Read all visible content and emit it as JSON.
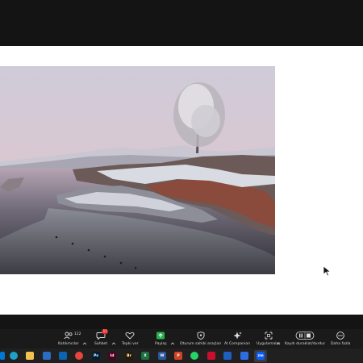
{
  "toolbar": {
    "participants": {
      "label": "Katılımcılar",
      "count": "122",
      "icon": "participants-icon"
    },
    "chat": {
      "label": "Sohbet",
      "badge": "11",
      "icon": "chat-icon"
    },
    "reactions": {
      "label": "Tepki ver",
      "icon": "heart-icon"
    },
    "share": {
      "label": "Paylaş",
      "icon": "share-screen-icon"
    },
    "host_tools": {
      "label": "Oturum sahibi araçları",
      "icon": "shield-icon"
    },
    "ai_companion": {
      "label": "AI Companion",
      "icon": "sparkle-icon"
    },
    "apps": {
      "label": "Uygulamalar",
      "icon": "apps-icon"
    },
    "record": {
      "label": "Kaydı duraklat/durdur",
      "icon": "pause-stop-icon"
    },
    "more": {
      "label": "Daha fazla",
      "icon": "more-icon"
    }
  },
  "taskbar": {
    "apps": [
      {
        "name": "windows-start-icon",
        "color": "#0078d4"
      },
      {
        "name": "edge-icon",
        "color": "#1ea0c8"
      },
      {
        "name": "file-explorer-icon",
        "color": "#f2c14e"
      },
      {
        "name": "calendar-icon",
        "color": "#2b6cc4"
      },
      {
        "name": "outlook-icon",
        "color": "#0a64b4"
      },
      {
        "name": "chrome-icon",
        "color": "#e8453c"
      },
      {
        "name": "photoshop-icon",
        "color": "#001e36",
        "text": "Ps"
      },
      {
        "name": "indesign-icon",
        "color": "#49021f",
        "text": "Id"
      },
      {
        "name": "bridge-icon",
        "color": "#2a1a00",
        "text": "Br"
      },
      {
        "name": "excel-icon",
        "color": "#1d6f42",
        "text": "X"
      },
      {
        "name": "word-icon",
        "color": "#2b579a",
        "text": "W"
      },
      {
        "name": "powerpoint-icon",
        "color": "#d04423",
        "text": "P"
      },
      {
        "name": "whatsapp-icon",
        "color": "#25d366"
      },
      {
        "name": "red-app-icon",
        "color": "#c8102e"
      },
      {
        "name": "blue-app-icon",
        "color": "#1f5fbf"
      },
      {
        "name": "diamond-app-icon",
        "color": "#2e6ddf"
      },
      {
        "name": "zoom-icon",
        "color": "#0b5cff",
        "text": "zm"
      }
    ]
  },
  "colors": {
    "toolbar_bg": "#1a1a1a",
    "share_green": "#27b04a",
    "badge_red": "#e02828"
  }
}
